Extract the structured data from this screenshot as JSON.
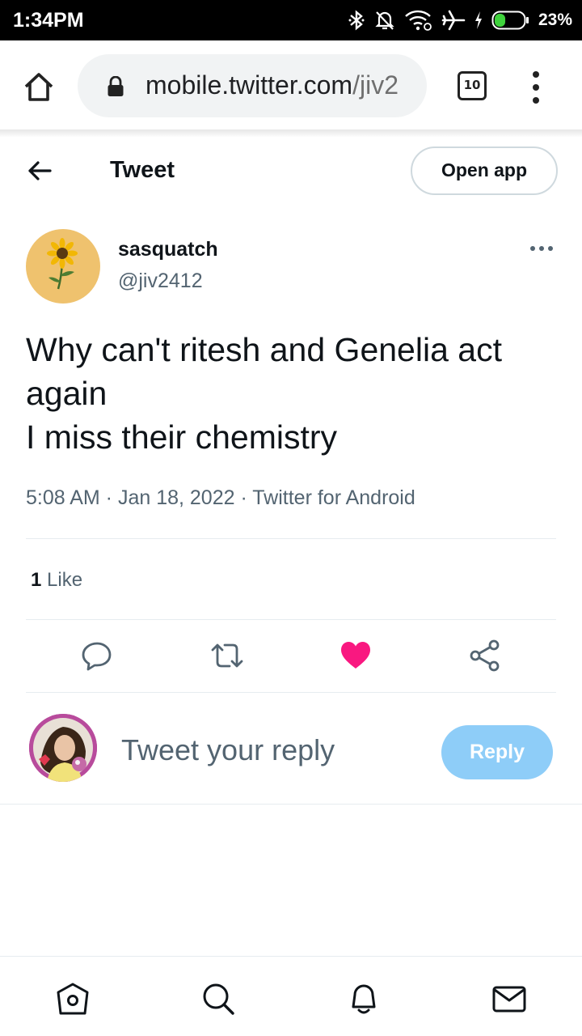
{
  "status_bar": {
    "time": "1:34PM",
    "battery_percent": "23%",
    "battery_level": 0.23,
    "icons": [
      "bluetooth-icon",
      "alarm-off-icon",
      "wifi-icon",
      "airplane-mode-icon",
      "charging-icon",
      "battery-icon"
    ]
  },
  "browser": {
    "url_host": "mobile.twitter.com",
    "url_path": "/jiv2",
    "tab_count": "10",
    "icons": [
      "home-icon",
      "lock-icon",
      "tabs-icon",
      "overflow-menu-icon"
    ]
  },
  "header": {
    "title": "Tweet",
    "open_app_label": "Open app",
    "back_icon": "arrow-left-icon"
  },
  "tweet": {
    "author_name": "sasquatch",
    "author_handle": "@jiv2412",
    "text_lines": [
      "Why can't ritesh and Genelia act",
      "again",
      "I miss their chemistry"
    ],
    "meta": "5:08 AM · Jan 18, 2022 · Twitter for Android",
    "like_count": "1",
    "like_label": "Like",
    "liked": true,
    "colors": {
      "like": "#f91880",
      "text": "#0f1419",
      "secondary": "#536471"
    }
  },
  "actions": {
    "icons": [
      "reply-icon",
      "retweet-icon",
      "like-icon",
      "share-icon"
    ]
  },
  "reply": {
    "placeholder": "Tweet your reply",
    "button_label": "Reply",
    "button_color": "#8ecdf8"
  },
  "bottom_nav": {
    "icons": [
      "home-icon",
      "search-icon",
      "notifications-icon",
      "messages-icon"
    ]
  }
}
